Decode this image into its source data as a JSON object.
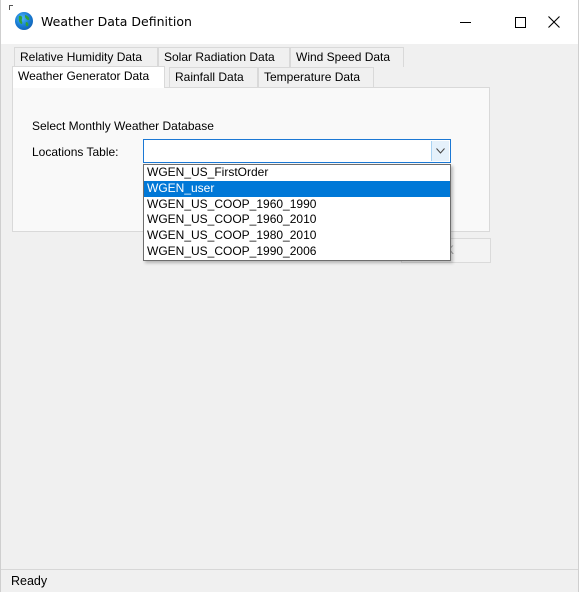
{
  "window": {
    "title": "Weather Data Definition",
    "icon": "globe-icon"
  },
  "tabs": {
    "row1": [
      "Relative Humidity Data",
      "Solar Radiation Data",
      "Wind Speed Data"
    ],
    "row2": [
      "Weather Generator Data",
      "Rainfall Data",
      "Temperature Data"
    ],
    "active": "Weather Generator Data"
  },
  "panel": {
    "heading": "Select Monthly Weather Database",
    "locations_label": "Locations Table:",
    "combo_value": ""
  },
  "dropdown": {
    "options": [
      "WGEN_US_FirstOrder",
      "WGEN_user",
      "WGEN_US_COOP_1960_1990",
      "WGEN_US_COOP_1960_2010",
      "WGEN_US_COOP_1980_2010",
      "WGEN_US_COOP_1990_2006"
    ],
    "highlighted": "WGEN_user"
  },
  "obscured_button_fragment": "K",
  "status": {
    "text": "Ready"
  },
  "colors": {
    "highlight": "#0078d7",
    "focus_border": "#1b78d4"
  }
}
